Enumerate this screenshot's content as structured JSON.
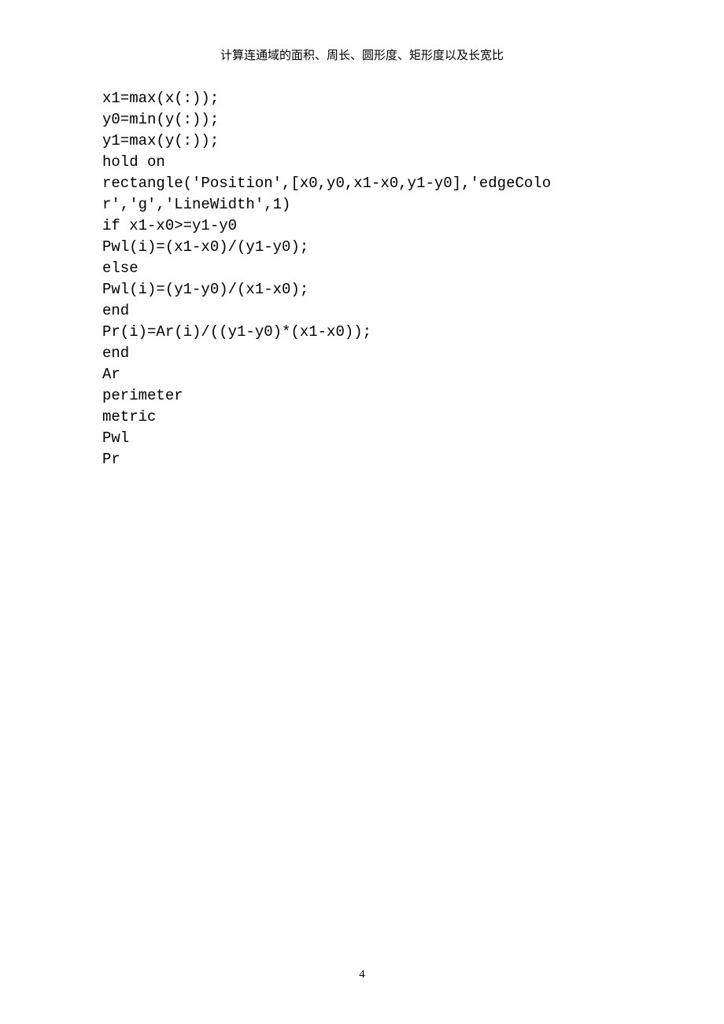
{
  "header": {
    "title": "计算连通域的面积、周长、圆形度、矩形度以及长宽比"
  },
  "code": {
    "lines": [
      "x1=max(x(:));",
      "y0=min(y(:));",
      "y1=max(y(:));",
      "hold on",
      "rectangle('Position',[x0,y0,x1-x0,y1-y0],'edgeColor','g','LineWidth',1)",
      "if x1-x0>=y1-y0",
      "Pwl(i)=(x1-x0)/(y1-y0);",
      "else",
      "Pwl(i)=(y1-y0)/(x1-x0);",
      "end",
      "Pr(i)=Ar(i)/((y1-y0)*(x1-x0));",
      "end",
      "Ar",
      "perimeter",
      "metric",
      "Pwl",
      "Pr"
    ]
  },
  "footer": {
    "page_number": "4"
  }
}
